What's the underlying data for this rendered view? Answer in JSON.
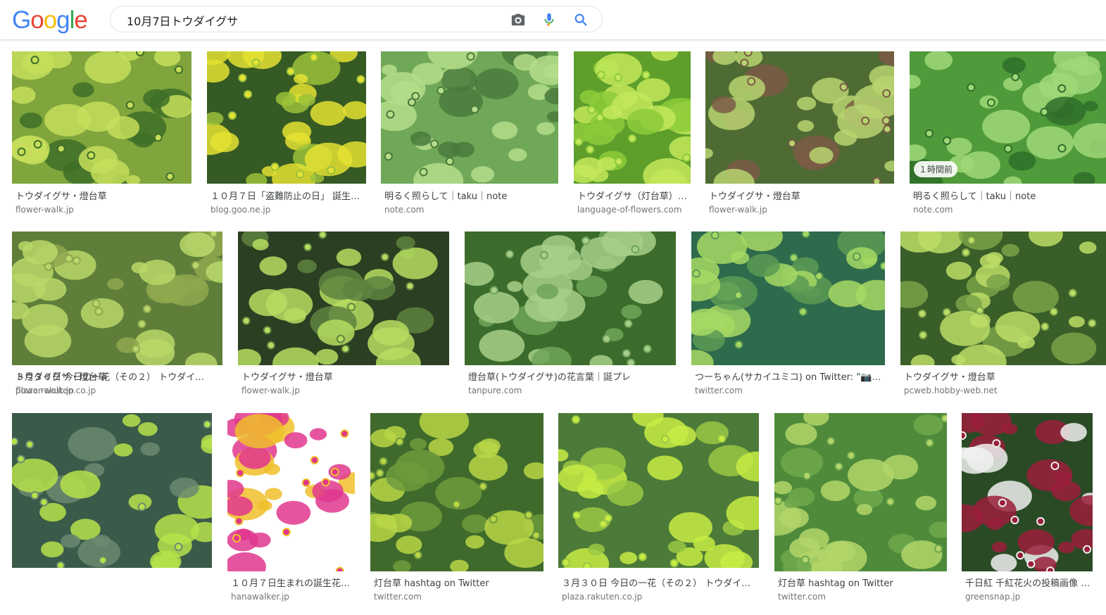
{
  "logo": {
    "letters": [
      "G",
      "o",
      "o",
      "g",
      "l",
      "e"
    ],
    "colors": [
      "#4285F4",
      "#EA4335",
      "#FBBC05",
      "#4285F4",
      "#34A853",
      "#EA4335"
    ]
  },
  "search": {
    "query": "10月7日トウダイグサ"
  },
  "results": [
    {
      "caption": "トウダイグサ・燈台草",
      "domain": "flower-walk.jp",
      "palette": [
        "#7fa53c",
        "#c6de5a",
        "#3e6e28"
      ]
    },
    {
      "caption": "１０月７日「盗難防止の日」 誕生花・燈台草",
      "domain": "blog.goo.ne.jp",
      "palette": [
        "#365a24",
        "#e4e233",
        "#9ac23a"
      ]
    },
    {
      "caption": "明るく照らして｜taku｜note",
      "domain": "note.com",
      "palette": [
        "#6fa858",
        "#b5dd8a",
        "#4a7a3c"
      ]
    },
    {
      "caption": "トウダイグサ（灯台草）の花言葉",
      "domain": "language-of-flowers.com",
      "palette": [
        "#5e9e2a",
        "#c3e85c",
        "#8ccb3a"
      ]
    },
    {
      "caption": "トウダイグサ・燈台草",
      "domain": "flower-walk.jp",
      "palette": [
        "#4e6b34",
        "#b7d370",
        "#7b5a45"
      ]
    },
    {
      "caption": "明るく照らして｜taku｜note",
      "domain": "note.com",
      "palette": [
        "#4f9a3a",
        "#9fd878",
        "#2f6e2a"
      ],
      "badge": "１時間前"
    },
    {
      "caption": "トウダイグサ・燈台草",
      "domain": "flower-walk.jp",
      "palette": [
        "#5e7e3a",
        "#b9d86a",
        "#8ea84e"
      ]
    },
    {
      "caption": "トウダイグサ・燈台草",
      "domain": "flower-walk.jp",
      "palette": [
        "#2b3f22",
        "#b6dd60",
        "#5e8340"
      ]
    },
    {
      "caption": "燈台草(トウダイグサ)の花言葉｜誕プレ",
      "domain": "tanpure.com",
      "palette": [
        "#3c6c2c",
        "#a7cf8a",
        "#6fa45a"
      ]
    },
    {
      "caption": "つーちゃん(サカイユミコ) on Twitter: \"📷 ...",
      "domain": "twitter.com",
      "palette": [
        "#2e6a4c",
        "#a6d864",
        "#5a9a54"
      ]
    },
    {
      "caption": "トウダイグサ・燈台草",
      "domain": "pcweb.hobby-web.net",
      "palette": [
        "#3a5e28",
        "#bcdd66",
        "#7aa248"
      ]
    },
    {
      "caption": "３月３０日 今日の一花（その２） トウダイグサ",
      "domain": "plaza.rakuten.co.jp",
      "palette": [
        "#3a5a4a",
        "#b6e24a",
        "#6c8a70"
      ]
    },
    {
      "caption": "１０月７日生まれの誕生花と花言葉",
      "domain": "hanawalker.jp",
      "palette": [
        "#ffffff",
        "#e0378e",
        "#f0c02a"
      ]
    },
    {
      "caption": "灯台草 hashtag on Twitter",
      "domain": "twitter.com",
      "palette": [
        "#3f6a2c",
        "#b8d646",
        "#6f9a3c"
      ]
    },
    {
      "caption": "３月３０日 今日の一花（その２） トウダイグサ",
      "domain": "plaza.rakuten.co.jp",
      "palette": [
        "#4c7a38",
        "#c7ec44",
        "#9ac844"
      ]
    },
    {
      "caption": "灯台草 hashtag on Twitter",
      "domain": "twitter.com",
      "palette": [
        "#4e8a3a",
        "#b3d66a",
        "#6ea84c"
      ]
    },
    {
      "caption": "千日紅 千紅花火の投稿画像 by ...",
      "domain": "greensnap.jp",
      "palette": [
        "#2a4a26",
        "#9a1e3a",
        "#eef0ee"
      ]
    }
  ]
}
